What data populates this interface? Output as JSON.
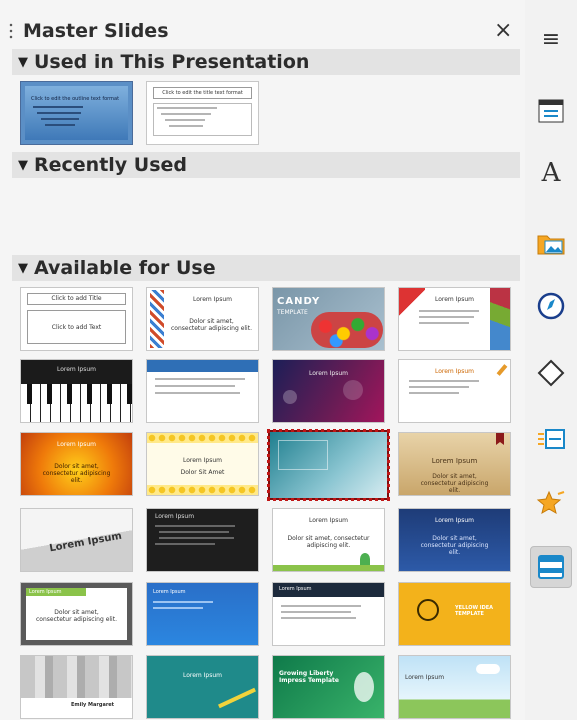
{
  "panel": {
    "title": "Master Slides",
    "close_label": "×"
  },
  "sections": {
    "used": "Used in This Presentation",
    "recent": "Recently Used",
    "available": "Available for Use"
  },
  "used_thumbs": [
    {
      "text": "Click to edit the outline text format"
    },
    {
      "text": "Click to edit the title text format"
    }
  ],
  "available_text": {
    "t1_title": "Click to add Title",
    "t1_body": "Click to add Text",
    "lorem": "Lorem Ipsum",
    "lorem_sub": "Dolor sit amet, consectetur adipiscing elit.",
    "candy": "CANDY",
    "candy_sub": "TEMPLATE",
    "dolor": "Dolor Sit Amet",
    "growing": "Growing Liberty Impress Template",
    "yellow": "YELLOW IDEA TEMPLATE",
    "grey_name": "Emily Margaret"
  },
  "sidebar": {
    "items": [
      {
        "name": "menu-icon",
        "label": "≡"
      },
      {
        "name": "properties-icon"
      },
      {
        "name": "styles-icon",
        "label": "A"
      },
      {
        "name": "gallery-icon"
      },
      {
        "name": "navigator-icon"
      },
      {
        "name": "shapes-icon"
      },
      {
        "name": "slide-transition-icon"
      },
      {
        "name": "animation-icon"
      },
      {
        "name": "master-slides-icon"
      }
    ]
  }
}
